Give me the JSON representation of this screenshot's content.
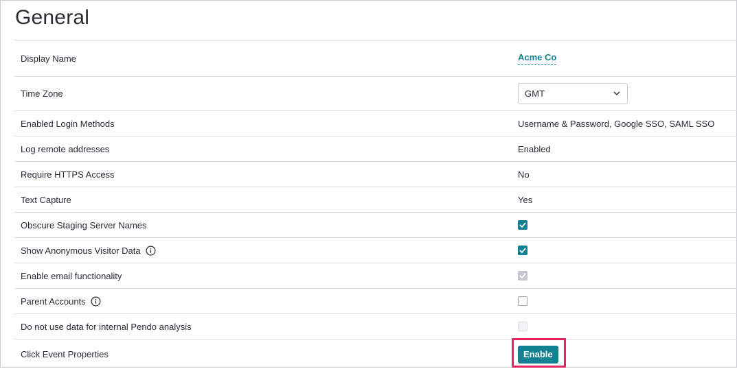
{
  "page": {
    "title": "General"
  },
  "settings": {
    "display_name": {
      "label": "Display Name",
      "value": "Acme Co"
    },
    "time_zone": {
      "label": "Time Zone",
      "value": "GMT"
    },
    "login_methods": {
      "label": "Enabled Login Methods",
      "value": "Username & Password, Google SSO, SAML SSO"
    },
    "log_remote": {
      "label": "Log remote addresses",
      "value": "Enabled"
    },
    "https": {
      "label": "Require HTTPS Access",
      "value": "No"
    },
    "text_capture": {
      "label": "Text Capture",
      "value": "Yes"
    },
    "obscure_staging": {
      "label": "Obscure Staging Server Names",
      "checked": true,
      "disabled": false
    },
    "anonymous_visitor": {
      "label": "Show Anonymous Visitor Data",
      "checked": true,
      "disabled": false
    },
    "email_functionality": {
      "label": "Enable email functionality",
      "checked": true,
      "disabled": true
    },
    "parent_accounts": {
      "label": "Parent Accounts",
      "checked": false,
      "disabled": false
    },
    "internal_analysis": {
      "label": "Do not use data for internal Pendo analysis",
      "checked": false,
      "disabled": true
    },
    "click_event": {
      "label": "Click Event Properties",
      "button_label": "Enable"
    }
  },
  "colors": {
    "accent": "#128292",
    "highlight": "#e5235f",
    "text": "#2a2c35",
    "divider": "#dadce0"
  },
  "icons": {
    "info": "info-circle-icon",
    "chevron": "chevron-down-icon",
    "check": "check-icon"
  }
}
